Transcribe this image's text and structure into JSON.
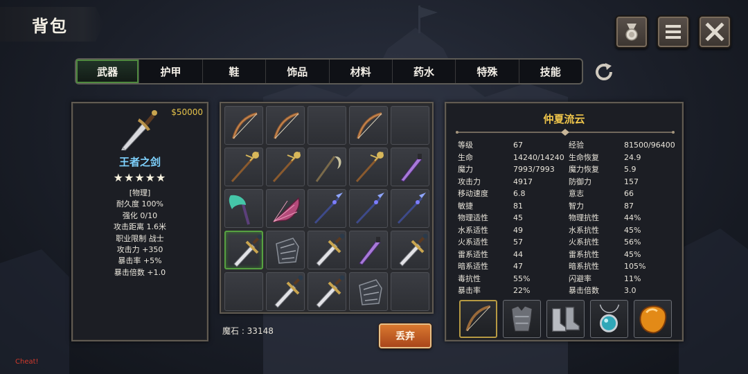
{
  "header": {
    "title": "背包"
  },
  "top_buttons": [
    {
      "icon": "medal-icon"
    },
    {
      "icon": "menu-icon"
    },
    {
      "icon": "close-icon"
    }
  ],
  "tabs": [
    "武器",
    "护甲",
    "鞋",
    "饰品",
    "材料",
    "药水",
    "特殊",
    "技能"
  ],
  "active_tab": "武器",
  "item_detail": {
    "price": "$50000",
    "name": "王者之剑",
    "stars": "★★★★★",
    "properties": [
      "[物理]",
      "耐久度 100%",
      "强化 0/10",
      "攻击距离  1.6米",
      "职业限制  战士",
      "攻击力  +350",
      "暴击率  +5%",
      "暴击倍数  +1.0"
    ]
  },
  "inventory": {
    "slots": [
      "bow-icon",
      "bow-icon",
      "",
      "bow-icon",
      "",
      "staff-icon",
      "staff-icon",
      "scythe-icon",
      "staff-icon",
      "dagger-icon",
      "axe-icon",
      "fan-icon",
      "spear-icon",
      "spear-icon",
      "spear-icon",
      "sword-icon",
      "gauntlet-icon",
      "sword-icon",
      "dagger-icon",
      "sword-icon",
      "",
      "sword-icon",
      "sword-icon",
      "gauntlet-icon",
      ""
    ],
    "selected_index": 15,
    "magic_stone": "魔石 : 33148",
    "drop_label": "丢弃"
  },
  "character": {
    "name": "仲夏流云",
    "stats": [
      [
        "等级",
        "67",
        "经验",
        "81500/96400"
      ],
      [
        "生命",
        "14240/14240",
        "生命恢复",
        "24.9"
      ],
      [
        "魔力",
        "7993/7993",
        "魔力恢复",
        "5.9"
      ],
      [
        "攻击力",
        "4917",
        "防御力",
        "157"
      ],
      [
        "移动速度",
        "6.8",
        "意志",
        "66"
      ],
      [
        "敏捷",
        "81",
        "智力",
        "87"
      ],
      [
        "物理适性",
        "45",
        "物理抗性",
        "44%"
      ],
      [
        "水系适性",
        "49",
        "水系抗性",
        "45%"
      ],
      [
        "火系适性",
        "57",
        "火系抗性",
        "56%"
      ],
      [
        "雷系适性",
        "44",
        "雷系抗性",
        "45%"
      ],
      [
        "暗系适性",
        "47",
        "暗系抗性",
        "105%"
      ],
      [
        "毒抗性",
        "55%",
        "闪避率",
        "11%"
      ],
      [
        "暴击率",
        "22%",
        "暴击倍数",
        "3.0"
      ]
    ],
    "equipment": [
      "bow-icon",
      "armor-icon",
      "boots-icon",
      "amulet-icon",
      "gem-icon"
    ]
  },
  "footer": {
    "cheat": "Cheat!"
  },
  "colors": {
    "accent_green": "#57a141",
    "gold": "#f0c64b",
    "item_blue": "#7fd3ff",
    "drop_orange": "#c45f25"
  }
}
